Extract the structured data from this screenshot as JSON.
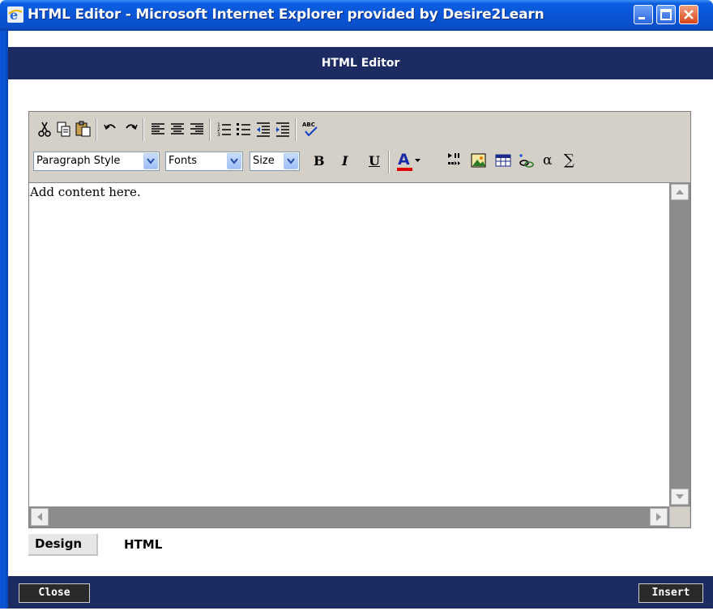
{
  "window": {
    "title": "HTML Editor - Microsoft Internet Explorer provided by Desire2Learn",
    "controls": [
      "minimize-icon",
      "maximize-icon",
      "close-icon"
    ]
  },
  "header": {
    "title": "HTML Editor"
  },
  "toolbar": {
    "row1_icons": [
      "cut-icon",
      "copy-icon",
      "paste-icon",
      "undo-icon",
      "redo-icon",
      "align-left-icon",
      "align-center-icon",
      "align-right-icon",
      "numbered-list-icon",
      "bullet-list-icon",
      "outdent-icon",
      "indent-icon",
      "spellcheck-icon"
    ],
    "paragraph_style": "Paragraph Style",
    "fonts": "Fonts",
    "size": "Size",
    "bold": "B",
    "italic": "I",
    "underline": "U",
    "font_color_letter": "A",
    "font_color": "#e00000",
    "row2_icons": [
      "media-icon",
      "image-icon",
      "table-icon",
      "link-icon",
      "alpha-icon",
      "sigma-icon"
    ],
    "alpha_symbol": "α",
    "sigma_symbol": "∑"
  },
  "editor": {
    "content": "Add content here."
  },
  "tabs": {
    "design": "Design",
    "html": "HTML"
  },
  "footer": {
    "close_label": "Close",
    "insert_label": "Insert"
  },
  "colors": {
    "band": "#1d2b63",
    "titlebar": "#0a55d6"
  }
}
